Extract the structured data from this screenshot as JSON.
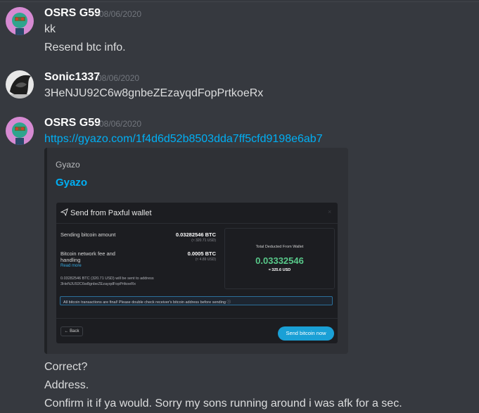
{
  "messages": [
    {
      "username": "OSRS G59",
      "timestamp": "08/06/2020",
      "lines": [
        "kk",
        "Resend btc info."
      ]
    },
    {
      "username": "Sonic1337",
      "timestamp": "08/06/2020",
      "lines": [
        "3HeNJU92C6w8gnbeZEzayqdFopPrtkoeRx"
      ]
    },
    {
      "username": "OSRS G59",
      "timestamp": "08/06/2020",
      "link": "https://gyazo.com/1f4d6d52b8503dda7ff5cfd9198e6ab7",
      "after": [
        "Correct?",
        "Address.",
        "Confirm it if ya would. Sorry my sons running around i was afk for a sec."
      ]
    }
  ],
  "embed": {
    "provider": "Gyazo",
    "title": "Gyazo",
    "image": {
      "title": "Send from Paxful wallet",
      "close": "×",
      "amount_label": "Sending bitcoin amount",
      "amount_btc": "0.03282546 BTC",
      "amount_usd": "(≈ 320.71 USD)",
      "fee_label_1": "Bitcoin network fee and",
      "fee_label_2": "handling",
      "fee_btc": "0.0005 BTC",
      "fee_usd": "(≈ 4.89 USD)",
      "read_more": "Read more",
      "sent_note": "0.03282546 BTC (320.71 USD) will be sent to address",
      "sent_address": "3HeNJU92C6w8gnbeZEzayqdFopPrtkoeRx",
      "total_label": "Total Deducted From Wallet",
      "total_btc": "0.03332546",
      "total_usd": "≈ 325.6 USD",
      "warning": "All bitcoin transactions are final! Please double check receiver's bitcoin address before sending ⓘ",
      "back": "← Back",
      "send_button": "Send bitcoin now"
    }
  },
  "colors": {
    "background": "#36393f",
    "link": "#00aff4",
    "paxful_green": "#58c98a",
    "paxful_button": "#1aa0d6"
  },
  "icons": {
    "avatar_osrs": "avatar-osrs-icon",
    "avatar_sonic": "avatar-sonic-icon",
    "send": "paper-plane-icon"
  }
}
